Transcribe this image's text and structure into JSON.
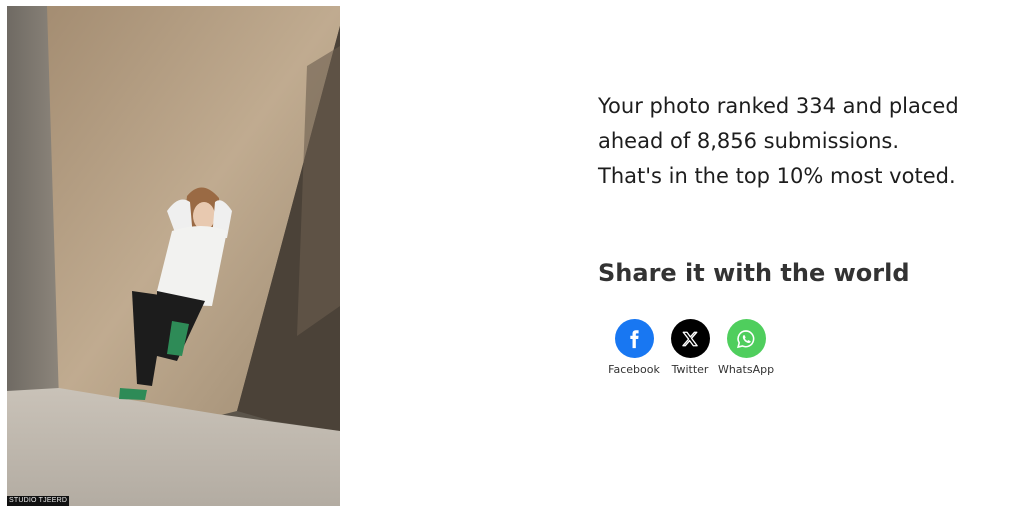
{
  "photo": {
    "watermark": "STUDIO TJEERD"
  },
  "result": {
    "line1": "Your photo ranked 334 and placed",
    "line2": "ahead of 8,856 submissions.",
    "line3": "That's in the top 10% most voted."
  },
  "share": {
    "title": "Share it with the world",
    "buttons": [
      {
        "label": "Facebook",
        "icon": "facebook-icon",
        "color": "#1877f2"
      },
      {
        "label": "Twitter",
        "icon": "x-icon",
        "color": "#000000"
      },
      {
        "label": "WhatsApp",
        "icon": "whatsapp-icon",
        "color": "#4fce5d"
      }
    ]
  }
}
